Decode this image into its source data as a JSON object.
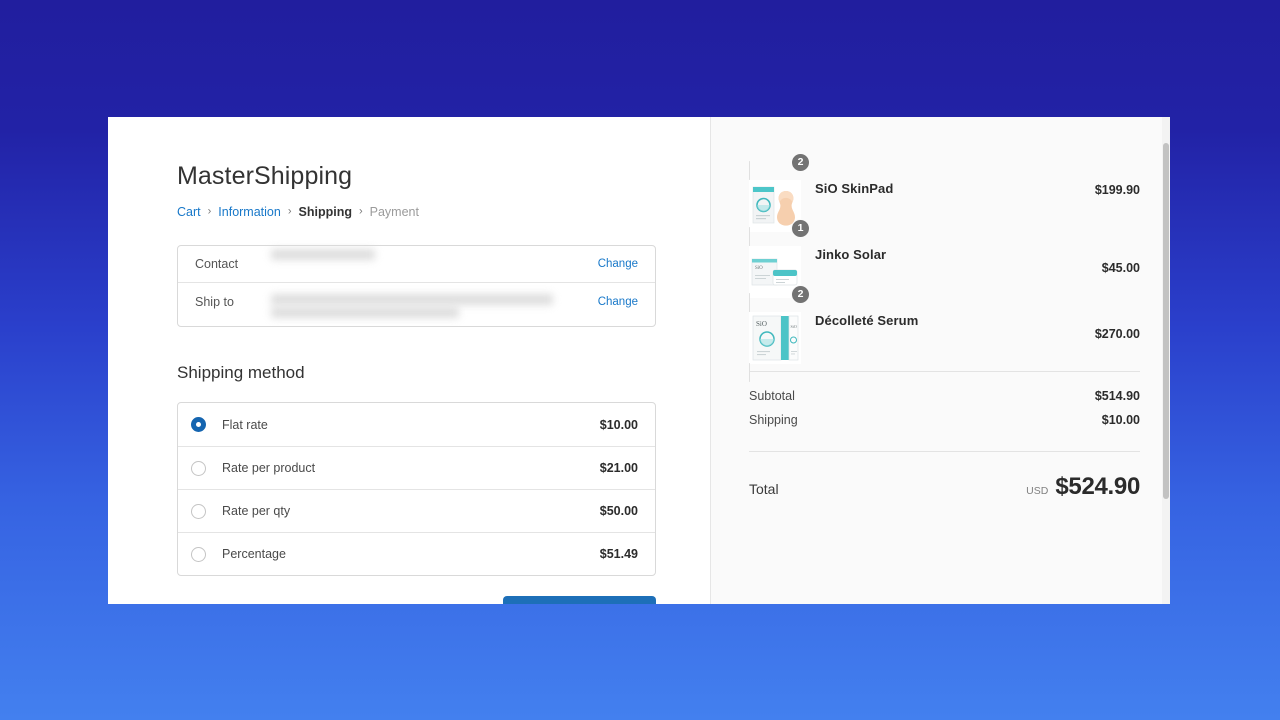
{
  "page": {
    "title": "MasterShipping"
  },
  "breadcrumb": {
    "items": [
      {
        "label": "Cart",
        "state": "link"
      },
      {
        "label": "Information",
        "state": "link"
      },
      {
        "label": "Shipping",
        "state": "current"
      },
      {
        "label": "Payment",
        "state": "muted"
      }
    ],
    "separator": "›"
  },
  "summary": {
    "contact_label": "Contact",
    "contact_value": "",
    "contact_change_label": "Change",
    "shipto_label": "Ship to",
    "shipto_value": "",
    "shipto_change_label": "Change"
  },
  "shipping": {
    "section_title": "Shipping method",
    "options": [
      {
        "label": "Flat rate",
        "price": "$10.00",
        "selected": true
      },
      {
        "label": "Rate per product",
        "price": "$21.00",
        "selected": false
      },
      {
        "label": "Rate per qty",
        "price": "$50.00",
        "selected": false
      },
      {
        "label": "Percentage",
        "price": "$51.49",
        "selected": false
      }
    ]
  },
  "actions": {
    "continue_label": ""
  },
  "order_summary": {
    "items": [
      {
        "name": "SiO SkinPad",
        "qty": "2",
        "price": "$199.90",
        "thumb": "sio-skinpad-box-with-pad"
      },
      {
        "name": "Jinko Solar",
        "qty": "1",
        "price": "$45.00",
        "thumb": "jinko-solar-box-with-jar"
      },
      {
        "name": "Décolleté Serum",
        "qty": "2",
        "price": "$270.00",
        "thumb": "decollete-serum-box"
      }
    ],
    "subtotal_label": "Subtotal",
    "subtotal_value": "$514.90",
    "shipping_label": "Shipping",
    "shipping_value": "$10.00",
    "total_label": "Total",
    "total_currency": "USD",
    "total_value": "$524.90"
  },
  "colors": {
    "background_top": "#211e9e",
    "background_bottom": "#4380ef",
    "link": "#1878c9",
    "radio_selected": "#1565b0",
    "button": "#1d6fb8",
    "badge": "#737373",
    "panel_right": "#fafafa"
  }
}
